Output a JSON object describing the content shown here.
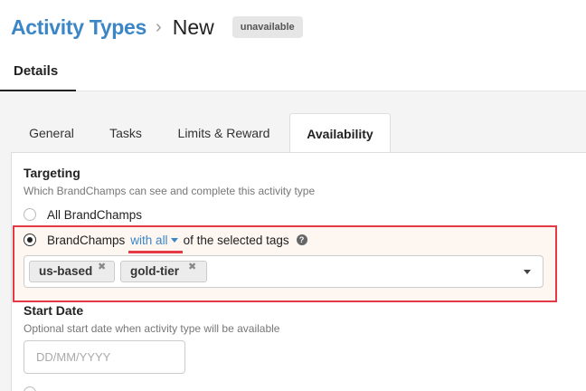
{
  "breadcrumb": {
    "parent": "Activity Types",
    "separator": "›",
    "current": "New"
  },
  "status_badge": "unavailable",
  "top_tabs": [
    {
      "label": "Details",
      "active": true
    }
  ],
  "sub_tabs": [
    {
      "label": "General",
      "active": false
    },
    {
      "label": "Tasks",
      "active": false
    },
    {
      "label": "Limits & Reward",
      "active": false
    },
    {
      "label": "Availability",
      "active": true
    }
  ],
  "targeting": {
    "title": "Targeting",
    "description": "Which BrandChamps can see and complete this activity type",
    "option_all": "All BrandChamps",
    "option_tagged_prefix": "BrandChamps",
    "match_mode": "with all",
    "option_tagged_suffix": "of the selected tags",
    "help_icon": "?",
    "selected_option": "tagged",
    "tags": [
      {
        "label": "us-based"
      },
      {
        "label": "gold-tier"
      }
    ],
    "tag_remove_glyph": "✖"
  },
  "start_date": {
    "title": "Start Date",
    "description": "Optional start date when activity type will be available",
    "placeholder": "DD/MM/YYYY",
    "value": ""
  },
  "colors": {
    "brand": "#3b86c6",
    "highlight": "#e53945"
  }
}
